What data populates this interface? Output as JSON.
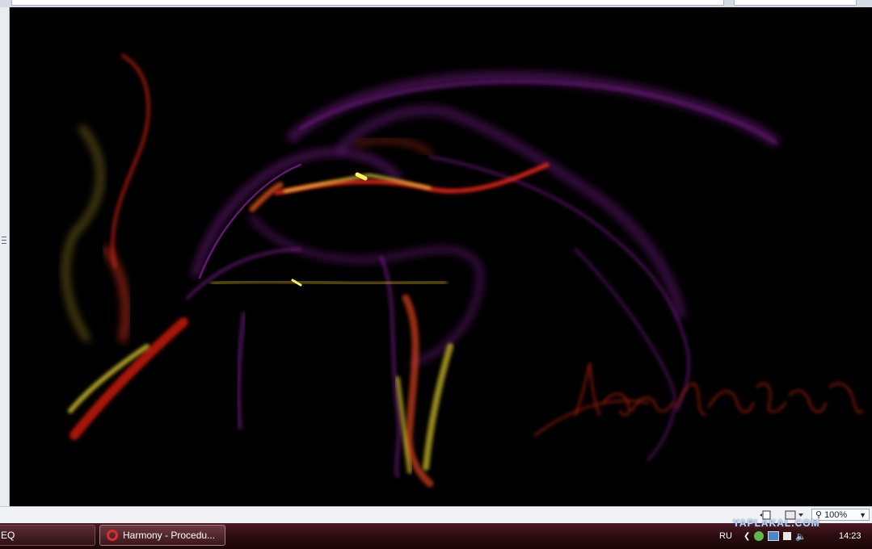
{
  "statusbar": {
    "zoom_value": "100%",
    "page_icon": "page-icon",
    "view_icon": "view-icon",
    "zoom_icon": "magnifier-icon"
  },
  "taskbar": {
    "items": [
      {
        "label": "EQ"
      },
      {
        "label": "Harmony - Procedu..."
      }
    ],
    "language": "RU",
    "clock": "14:23",
    "watermark": "YAPLAKAL.COM"
  },
  "colors": {
    "purple": "#7a1d8a",
    "red": "#e01a10",
    "yellow": "#e6d230",
    "orange": "#d2501a"
  }
}
